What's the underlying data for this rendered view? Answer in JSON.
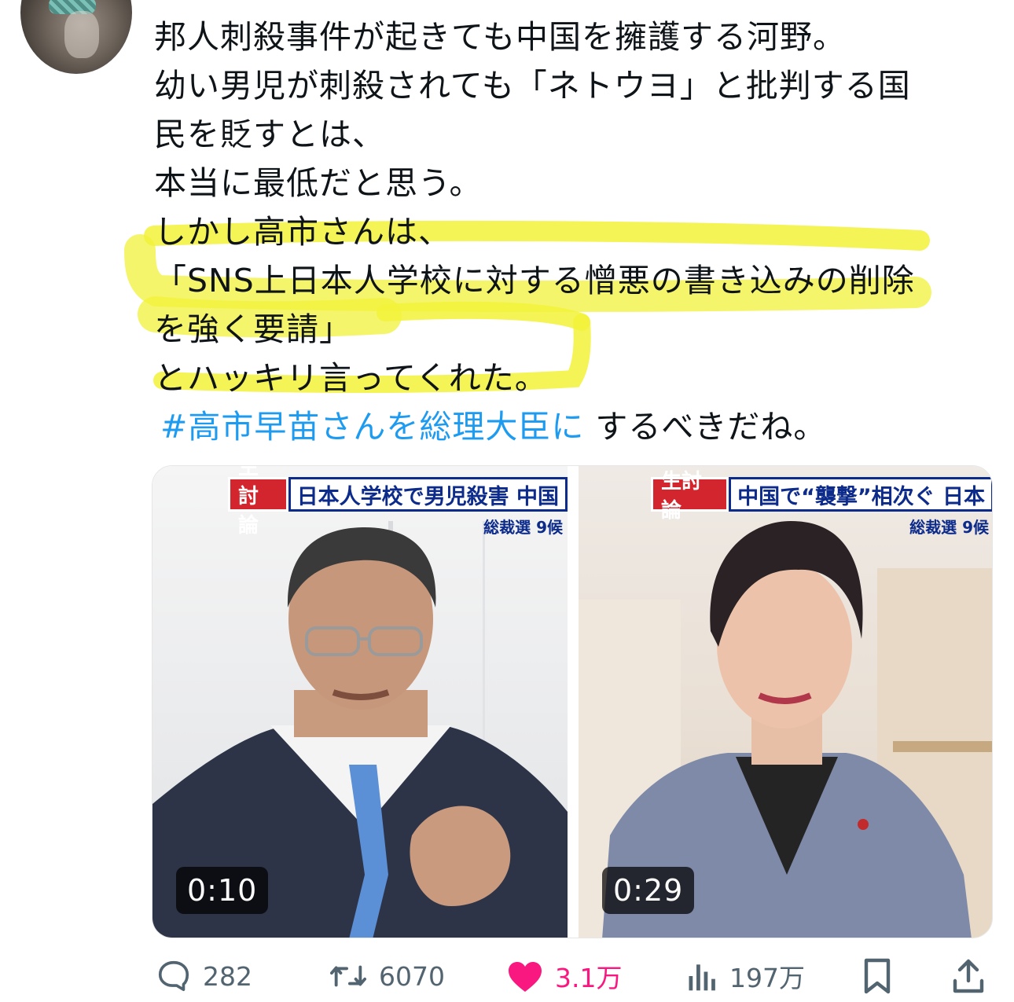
{
  "tweet": {
    "lines": [
      "邦人刺殺事件が起きても中国を擁護する河野。",
      " 幼い男児が刺殺されても「ネトウヨ」と批判する国",
      "民を貶すとは、",
      " 本当に最低だと思う。",
      "しかし高市さんは、",
      "「SNS上日本人学校に対する憎悪の書き込みの削除",
      "を強く要請」",
      "とハッキリ言ってくれた。"
    ],
    "hashtag": "#高市早苗さんを総理大臣に",
    "hashtag_suffix": " するべきだね。"
  },
  "media": {
    "left": {
      "tag": "生討論",
      "headline": "日本人学校で男児殺害 中国",
      "subline": "総裁選 9候",
      "duration": "0:10"
    },
    "right": {
      "tag": "生討論",
      "headline": "中国で“襲撃”相次ぐ 日本",
      "subline": "総裁選 9候",
      "duration": "0:29"
    }
  },
  "actions": {
    "replies": "282",
    "reposts": "6070",
    "likes": "3.1万",
    "views": "197万"
  },
  "colors": {
    "hashtag": "#1d9bf0",
    "like": "#f91880",
    "muted": "#536471",
    "highlight": "#f2f23a"
  }
}
